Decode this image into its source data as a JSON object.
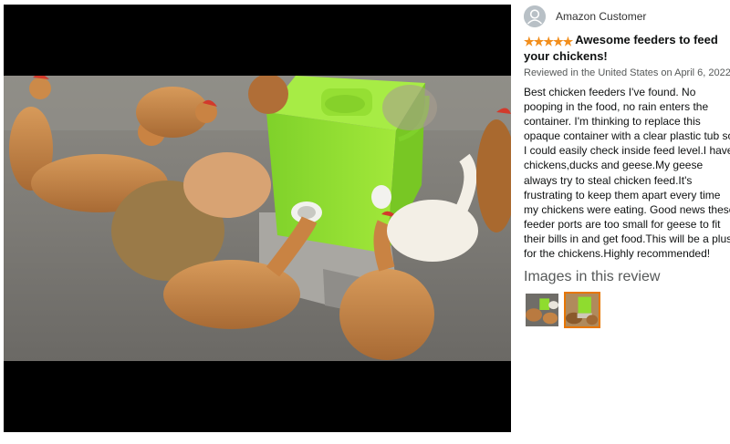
{
  "review": {
    "reviewer_name": "Amazon Customer",
    "rating": 5,
    "rating_max": 5,
    "title": "Awesome feeders to feed your chickens!",
    "date_line": "Reviewed in the United States on April 6, 2022",
    "body": "Best chicken feeders I've found. No pooping in the food, no rain enters the container. I'm thinking to replace this opaque container with a clear plastic tub so I could easily check inside feed level.I have chickens,ducks and geese.My geese always try to steal chicken feed.It's frustrating to keep them apart every time my chickens were eating. Good news these feeder ports are too small for geese to fit their bills in and get food.This will be a plus for the chickens.Highly recommended!"
  },
  "images_section": {
    "heading": "Images in this review",
    "thumbnails": [
      {
        "name": "thumbnail-1",
        "selected": false
      },
      {
        "name": "thumbnail-2",
        "selected": true
      }
    ]
  },
  "icons": {
    "avatar": "user-avatar-icon",
    "star": "star-icon"
  },
  "colors": {
    "star": "#f28e1c",
    "selected_thumb_border": "#e77600",
    "feeder_green": "#8fdc2f",
    "viewer_background": "#000000"
  }
}
